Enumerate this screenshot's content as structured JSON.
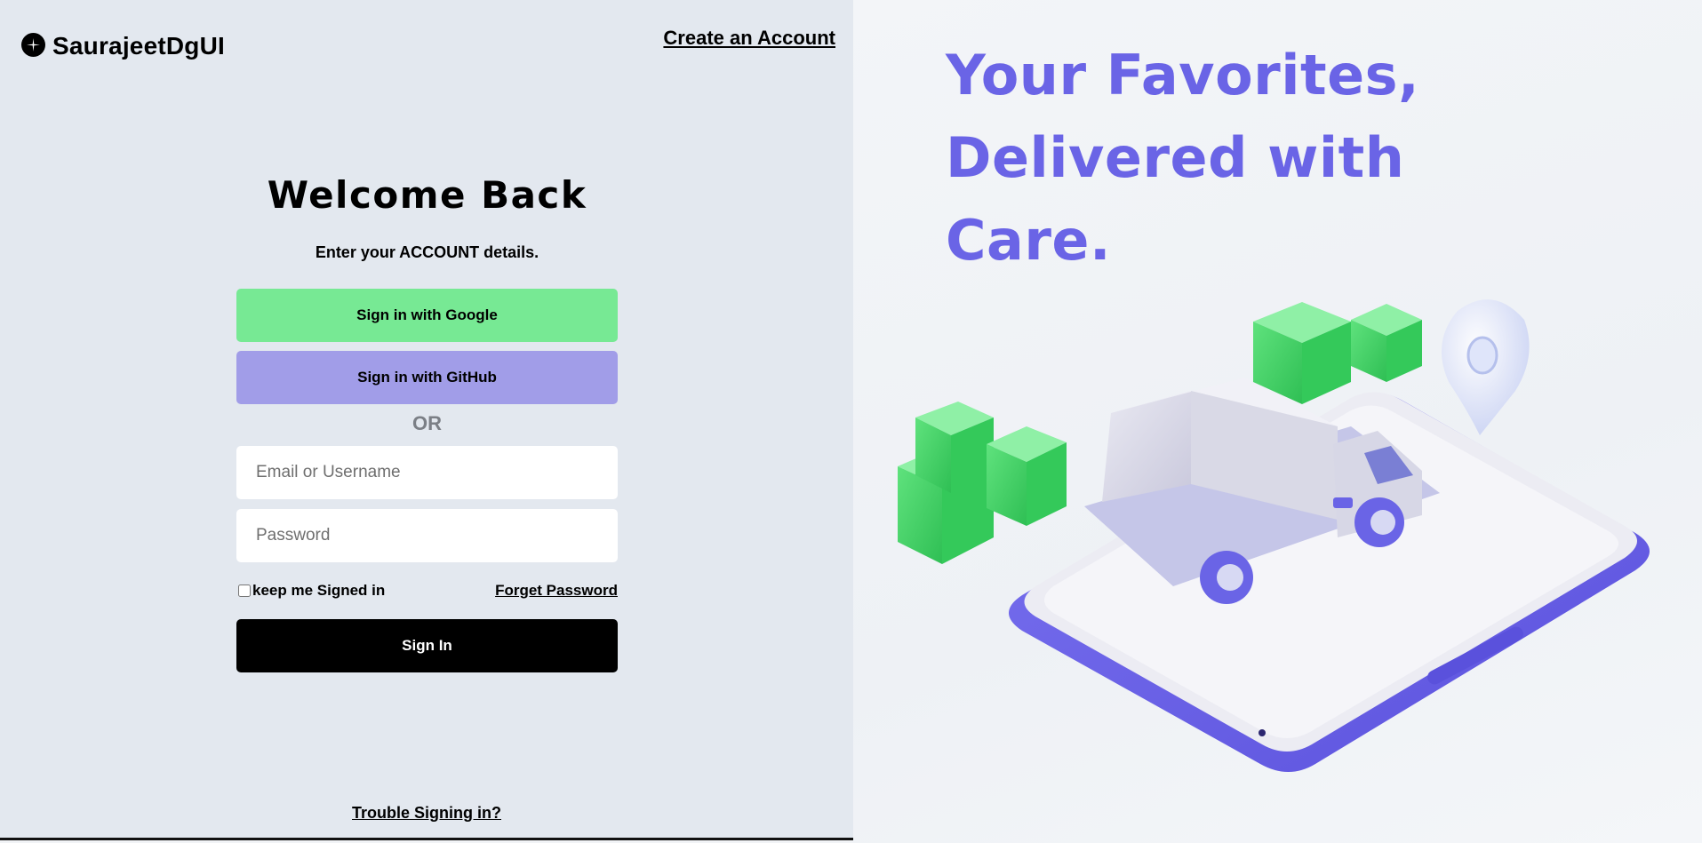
{
  "brand": {
    "name": "SaurajeetDgUI",
    "icon": "plus-circle-icon"
  },
  "header": {
    "create_account": "Create an Account"
  },
  "login": {
    "title": "Welcome Back",
    "subtitle": "Enter your ACCOUNT details.",
    "google_button": "Sign in with Google",
    "github_button": "Sign in with GitHub",
    "divider": "OR",
    "email_placeholder": "Email or Username",
    "password_placeholder": "Password",
    "keep_signed_in": "keep me Signed in",
    "forget_password": "Forget Password",
    "sign_in_button": "Sign In",
    "trouble": "Trouble Signing in?"
  },
  "hero": {
    "headline": "Your Favorites, Delivered with Care.",
    "illustration": "delivery-truck-on-phone-illustration"
  },
  "colors": {
    "left_background": "#e3e8ef",
    "google": "#77e994",
    "github": "#a19de8",
    "accent": "#6a64e6",
    "signin": "#000000"
  }
}
